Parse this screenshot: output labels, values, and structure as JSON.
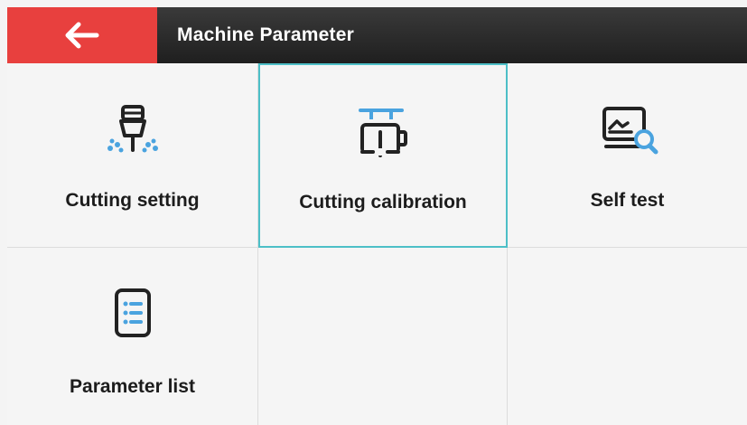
{
  "header": {
    "title": "Machine Parameter",
    "back_icon": "arrow-left-icon",
    "accent_color": "#e8403e"
  },
  "tiles": [
    {
      "label": "Cutting setting",
      "icon": "cutter-spray-icon",
      "selected": false
    },
    {
      "label": "Cutting calibration",
      "icon": "calibration-icon",
      "selected": true
    },
    {
      "label": "Self test",
      "icon": "monitor-search-icon",
      "selected": false
    },
    {
      "label": "Parameter list",
      "icon": "list-document-icon",
      "selected": false
    }
  ],
  "colors": {
    "icon_dark": "#222222",
    "icon_blue": "#4aa3df",
    "selection": "#4dbfc7"
  }
}
